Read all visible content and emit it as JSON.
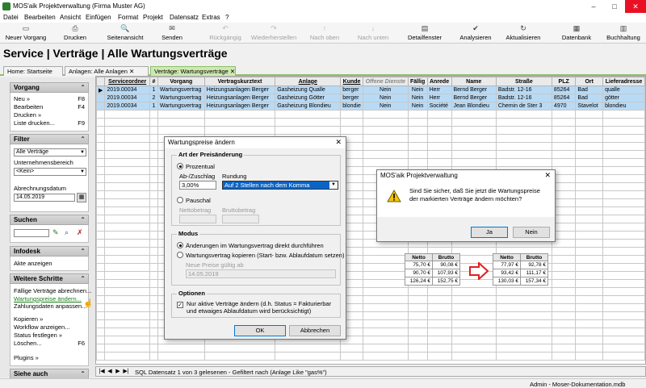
{
  "app": {
    "title": "MOS'aik Projektverwaltung (Firma Muster AG)",
    "window_buttons": {
      "minimize": "–",
      "maximize": "□",
      "close": "✕"
    }
  },
  "menu": [
    "Datei",
    "Bearbeiten",
    "Ansicht",
    "Einfügen",
    "Format",
    "Projekt",
    "Datensatz",
    "Extras",
    "?"
  ],
  "toolbar": [
    {
      "label": "Neuer Vorgang",
      "icon": "new-icon",
      "glyph": "▭",
      "enabled": true
    },
    {
      "label": "Drucken",
      "icon": "printer-icon",
      "glyph": "⎙",
      "enabled": true
    },
    {
      "label": "Seitenansicht",
      "icon": "preview-icon",
      "glyph": "🔍",
      "enabled": true
    },
    {
      "label": "Senden",
      "icon": "envelope-icon",
      "glyph": "✉",
      "enabled": true
    },
    {
      "label": "Rückgängig",
      "icon": "undo-icon",
      "glyph": "↶",
      "enabled": false
    },
    {
      "label": "Wiederherstellen",
      "icon": "redo-icon",
      "glyph": "↷",
      "enabled": false
    },
    {
      "label": "Nach oben",
      "icon": "arrow-up-icon",
      "glyph": "↑",
      "enabled": false
    },
    {
      "label": "Nach unten",
      "icon": "arrow-down-icon",
      "glyph": "↓",
      "enabled": false
    },
    {
      "label": "Detailfenster",
      "icon": "details-icon",
      "glyph": "▤",
      "enabled": true
    },
    {
      "label": "Analysieren",
      "icon": "analyze-icon",
      "glyph": "✔",
      "enabled": true
    },
    {
      "label": "Aktualisieren",
      "icon": "refresh-icon",
      "glyph": "↻",
      "enabled": true
    },
    {
      "label": "Datenbank",
      "icon": "database-icon",
      "glyph": "▦",
      "enabled": true
    },
    {
      "label": "Buchhaltung",
      "icon": "accounting-icon",
      "glyph": "▥",
      "enabled": true
    }
  ],
  "page_title": "Service | Verträge | Alle Wartungsverträge",
  "tabs": [
    {
      "label": "Home: Startseite",
      "active": false
    },
    {
      "label": "Anlagen: Alle Anlagen ✕",
      "active": false
    },
    {
      "label": "Verträge: Wartungsverträge ✕",
      "active": true
    }
  ],
  "sidebar": {
    "vorgang": {
      "title": "Vorgang",
      "items": [
        {
          "label": "Neu »",
          "key": "F8"
        },
        {
          "label": "Bearbeiten",
          "key": "F4"
        },
        {
          "label": "Drucken »",
          "key": ""
        },
        {
          "label": "Liste drucken...",
          "key": "F9"
        }
      ]
    },
    "filter": {
      "title": "Filter",
      "select1": "Alle Verträge",
      "bereich_label": "Unternehmensbereich",
      "select2": "<Kein>",
      "datum_label": "Abrechnungsdatum",
      "datum": "14.05.2019"
    },
    "suchen": {
      "title": "Suchen",
      "value": ""
    },
    "infodesk": {
      "title": "Infodesk",
      "items": [
        "Akte anzeigen"
      ]
    },
    "weitere": {
      "title": "Weitere Schritte",
      "items": [
        {
          "label": "Fällige Verträge abrechnen...",
          "key": ""
        },
        {
          "label": "Wartungspreise ändern...",
          "key": ""
        },
        {
          "label": "Zahlungsdaten anpassen...",
          "key": ""
        },
        {
          "label": "Kopieren »",
          "key": ""
        },
        {
          "label": "Workflow anzeigen...",
          "key": ""
        },
        {
          "label": "Status festlegen »",
          "key": ""
        },
        {
          "label": "Löschen...",
          "key": "F6"
        },
        {
          "label": "Plugins »",
          "key": ""
        }
      ]
    },
    "siehe": {
      "title": "Siehe auch"
    },
    "chevron": "⌃"
  },
  "grid": {
    "columns": [
      "",
      "Serviceordner",
      "#",
      "Vorgang",
      "Vertragskurztext",
      "Anlage",
      "Kunde",
      "Offene Dienste",
      "Fällig",
      "Anrede",
      "Name",
      "Straße",
      "PLZ",
      "Ort",
      "Lieferadresse"
    ],
    "rows": [
      [
        "▶",
        "2019.00034",
        "1",
        "Wartungsvertrag",
        "Heizungsanlagen Berger",
        "Gasheizung Qualle",
        "berger",
        "Nein",
        "Nein",
        "Herr",
        "Bernd Berger",
        "Badstr. 12-16",
        "85264",
        "Bad",
        "qualle"
      ],
      [
        "",
        "2019.00034",
        "2",
        "Wartungsvertrag",
        "Heizungsanlagen Berger",
        "Gasheizung Götter",
        "berger",
        "Nein",
        "Nein",
        "Herr",
        "Bernd Berger",
        "Badstr. 12-16",
        "85264",
        "Bad",
        "götter"
      ],
      [
        "",
        "2019.00034",
        "1",
        "Wartungsvertrag",
        "Heizungsanlagen Berger",
        "Gasheizung Blondieu",
        "blondie",
        "Nein",
        "Nein",
        "Société",
        "Jean Blondieu",
        "Chemin de Ster 3",
        "4970",
        "Stavelot",
        "blondieu"
      ]
    ]
  },
  "statusbar": {
    "text": "SQL Datensatz 1 von 3 gelesenen - Gefiltert nach (Anlage Like \"gas%\")",
    "nav": [
      "|◀",
      "◀",
      "▶",
      "▶|"
    ]
  },
  "app_status": "Admin - Moser-Dokumentation.mdb",
  "dialog_preise": {
    "title": "Wartungspreise ändern",
    "close": "✕",
    "group1": "Art der Preisänderung",
    "prozentual": "Prozentual",
    "ab_zuschlag": "Ab-/Zuschlag",
    "ab_zuschlag_value": "3,00%",
    "rundung": "Rundung",
    "rundung_value": "Auf 2 Stellen nach dem Komma",
    "pauschal": "Pauschal",
    "nettobetrag": "Nettobetrag",
    "bruttobetrag": "Bruttobetrag",
    "group2": "Modus",
    "modus1": "Änderungen im Wartungsvertrag direkt durchführen",
    "modus2": "Wartungsvertrag kopieren (Start- bzw. Ablaufdatum setzen)",
    "neue_preise_label": "Neue Preise gültig ab",
    "neue_preise_value": "14.05.2019",
    "group3": "Optionen",
    "option_text": "Nur aktive Verträge ändern (d.h. Status = Fakturierbar und etwaiges Ablaufdatum wird berücksichtigt)",
    "ok": "OK",
    "cancel": "Abbrechen"
  },
  "dialog_confirm": {
    "title": "MOS'aik Projektverwaltung",
    "close": "✕",
    "message": "Sind Sie sicher, daß Sie jetzt die Wartungspreise der markierten Verträge ändern möchten?",
    "yes": "Ja",
    "no": "Nein"
  },
  "price_before": {
    "headers": [
      "Netto",
      "Brutto"
    ],
    "rows": [
      [
        "75,70 €",
        "90,08 €"
      ],
      [
        "90,70 €",
        "107,93 €"
      ],
      [
        "126,24 €",
        "152,75 €"
      ]
    ]
  },
  "price_after": {
    "headers": [
      "Netto",
      "Brutto"
    ],
    "rows": [
      [
        "77,97 €",
        "92,78 €"
      ],
      [
        "93,42 €",
        "111,17 €"
      ],
      [
        "130,03 €",
        "157,34 €"
      ]
    ]
  },
  "colors": {
    "accent_green": "#8fbf6a",
    "selection_blue": "#b9daf5",
    "arrow_red": "#e02020",
    "link_green": "#1a7f1a"
  }
}
